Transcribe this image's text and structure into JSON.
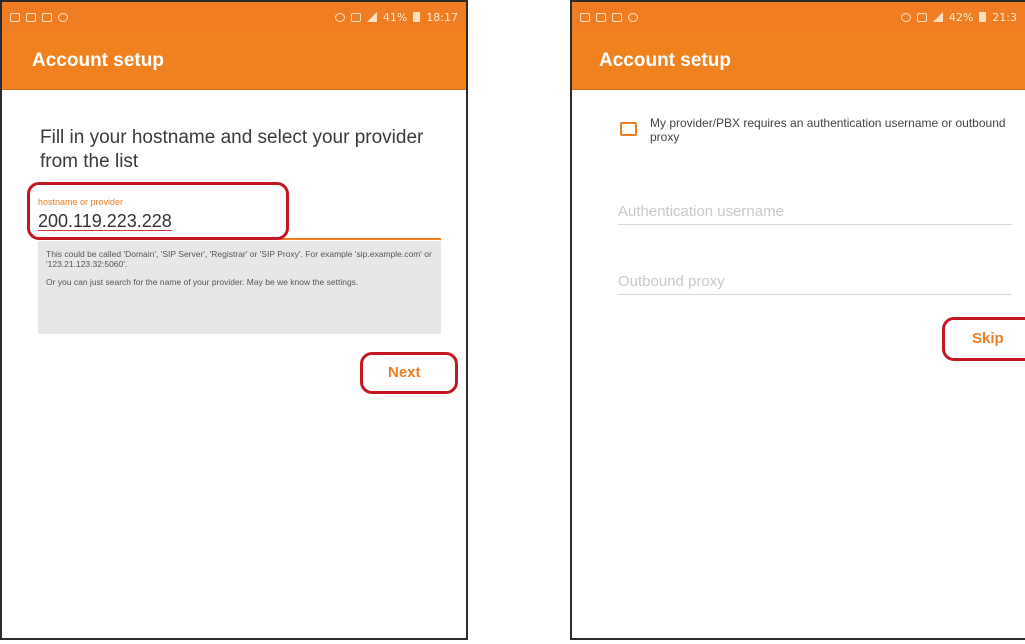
{
  "left_screen": {
    "status_bar": {
      "left_icons": [
        "message-icon",
        "image-icon",
        "chat-icon",
        "clock-icon"
      ],
      "right_text": "41%",
      "time": "18:17"
    },
    "app_bar": {
      "title": "Account setup"
    },
    "heading": "Fill in your hostname and select your provider from the list",
    "hostname_field": {
      "label": "hostname or provider",
      "value": "200.119.223.228"
    },
    "hint": {
      "line1": "This could be called 'Domain', 'SIP Server', 'Registrar' or 'SIP Proxy'. For example 'sip.example.com' or '123.21.123.32:5060'.",
      "line2": "Or you can just search for the name of your provider. May be we know the settings."
    },
    "next_button": "Next"
  },
  "right_screen": {
    "status_bar": {
      "left_icons": [
        "email-icon",
        "message-icon",
        "chat-icon",
        "play-icon"
      ],
      "right_text": "42%",
      "time": "21:3"
    },
    "app_bar": {
      "title": "Account setup"
    },
    "auth_checkbox": {
      "label": "My provider/PBX requires an authentication username or outbound proxy",
      "checked": false
    },
    "auth_username": {
      "placeholder": "Authentication username",
      "value": ""
    },
    "outbound_proxy": {
      "placeholder": "Outbound proxy",
      "value": ""
    },
    "skip_button": "Skip"
  },
  "colors": {
    "accent": "#f07d22",
    "highlight": "#c5171f",
    "hint_bg": "#e7e7e7"
  }
}
